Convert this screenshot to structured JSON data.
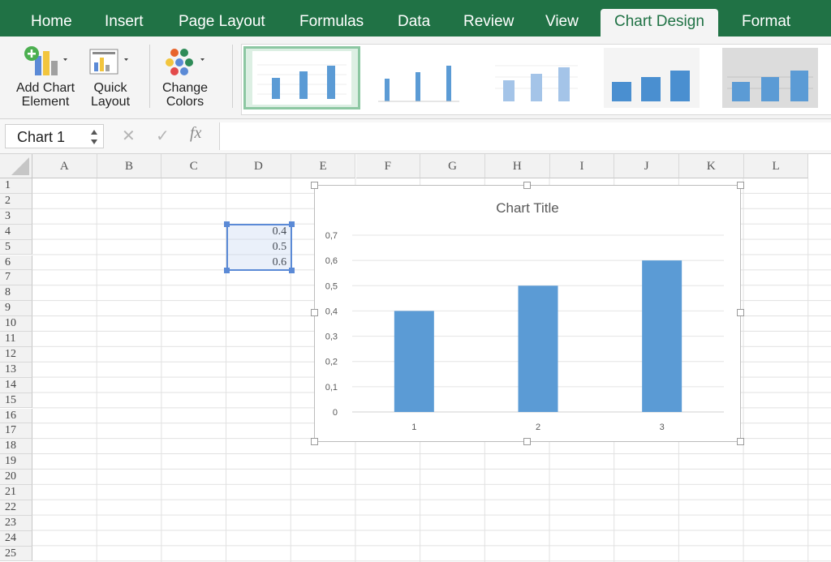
{
  "ribbon_tabs": [
    "Home",
    "Insert",
    "Page Layout",
    "Formulas",
    "Data",
    "Review",
    "View",
    "Chart Design",
    "Format"
  ],
  "active_tab": "Chart Design",
  "ribbon_buttons": {
    "add_chart_element": "Add Chart\nElement",
    "quick_layout": "Quick\nLayout",
    "change_colors": "Change\nColors"
  },
  "formula_bar": {
    "name_box": "Chart 1",
    "cancel_icon": "✕",
    "enter_icon": "✓",
    "fx_label": "fx",
    "formula": ""
  },
  "columns": [
    "A",
    "B",
    "C",
    "D",
    "E",
    "F",
    "G",
    "H",
    "I",
    "J",
    "K",
    "L"
  ],
  "rows": [
    "1",
    "2",
    "3",
    "4",
    "5",
    "6",
    "7",
    "8",
    "9",
    "10",
    "11",
    "12",
    "13",
    "14",
    "15",
    "16",
    "17",
    "18",
    "19",
    "20",
    "21",
    "22",
    "23",
    "24",
    "25"
  ],
  "cells": [
    {
      "ref": "D4",
      "value": "0.4"
    },
    {
      "ref": "D5",
      "value": "0.5"
    },
    {
      "ref": "D6",
      "value": "0.6"
    }
  ],
  "chart_data": {
    "type": "bar",
    "title": "Chart Title",
    "categories": [
      "1",
      "2",
      "3"
    ],
    "values": [
      0.4,
      0.5,
      0.6
    ],
    "ylim": [
      0,
      0.7
    ],
    "yticks": [
      "0",
      "0,1",
      "0,2",
      "0,3",
      "0,4",
      "0,5",
      "0,6",
      "0,7"
    ],
    "xlabel": "",
    "ylabel": "",
    "grid": true,
    "bar_color": "#5b9bd5"
  },
  "colors": {
    "ribbon_green": "#207245",
    "selection_blue": "#5b8ad6"
  }
}
